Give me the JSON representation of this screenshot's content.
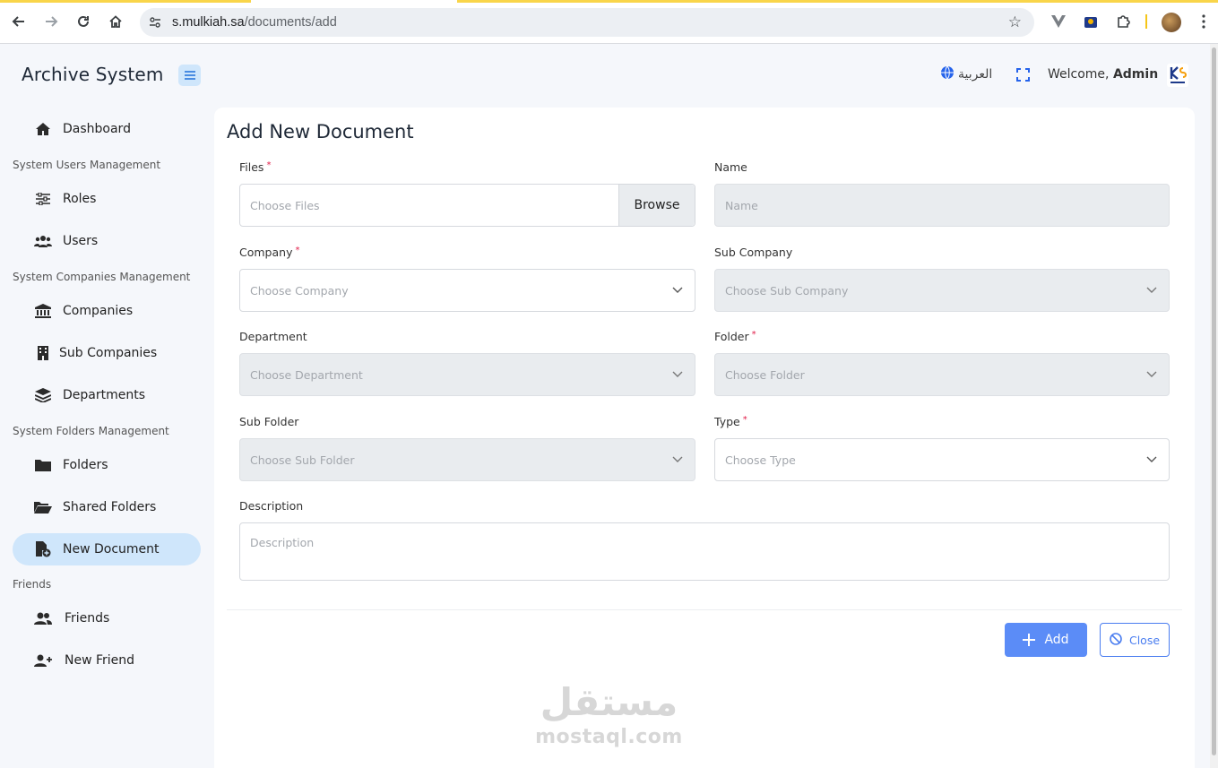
{
  "browser": {
    "url_host": "s.mulkiah.sa",
    "url_path": "/documents/add"
  },
  "header": {
    "brand": "Archive System",
    "language": "العربية",
    "welcome_prefix": "Welcome,",
    "welcome_user": "Admin"
  },
  "sidebar": {
    "dashboard": "Dashboard",
    "section_users": "System Users Management",
    "roles": "Roles",
    "users": "Users",
    "section_companies": "System Companies Management",
    "companies": "Companies",
    "sub_companies": "Sub Companies",
    "departments": "Departments",
    "section_folders": "System Folders Management",
    "folders": "Folders",
    "shared_folders": "Shared Folders",
    "new_document": "New Document",
    "section_friends": "Friends",
    "friends": "Friends",
    "new_friend": "New Friend"
  },
  "form": {
    "title": "Add New Document",
    "files_label": "Files",
    "files_placeholder": "Choose Files",
    "browse_label": "Browse",
    "name_label": "Name",
    "name_placeholder": "Name",
    "company_label": "Company",
    "company_placeholder": "Choose Company",
    "sub_company_label": "Sub Company",
    "sub_company_placeholder": "Choose Sub Company",
    "department_label": "Department",
    "department_placeholder": "Choose Department",
    "folder_label": "Folder",
    "folder_placeholder": "Choose Folder",
    "sub_folder_label": "Sub Folder",
    "sub_folder_placeholder": "Choose Sub Folder",
    "type_label": "Type",
    "type_placeholder": "Choose Type",
    "description_label": "Description",
    "description_placeholder": "Description",
    "required_mark": "*",
    "add_label": "Add",
    "close_label": "Close"
  },
  "watermark": {
    "arabic": "مستقل",
    "latin": "mostaql.com"
  },
  "colors": {
    "accent": "#5b8cf7",
    "active_nav_bg": "#cfe6fb",
    "required": "#e11d48"
  }
}
